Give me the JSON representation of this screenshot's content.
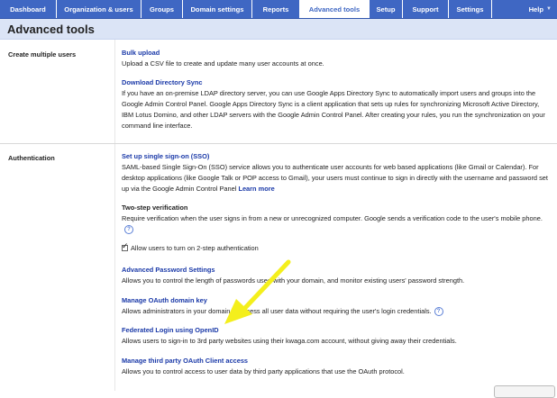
{
  "nav": {
    "tabs": [
      {
        "label": "Dashboard"
      },
      {
        "label": "Organization & users"
      },
      {
        "label": "Groups"
      },
      {
        "label": "Domain settings"
      },
      {
        "label": "Reports"
      },
      {
        "label": "Advanced tools",
        "active": true
      },
      {
        "label": "Setup"
      },
      {
        "label": "Support"
      },
      {
        "label": "Settings"
      }
    ],
    "help_label": "Help"
  },
  "page": {
    "title": "Advanced tools"
  },
  "sections": {
    "create_users": {
      "label": "Create multiple users",
      "bulk_upload": {
        "title": "Bulk upload",
        "text": "Upload a CSV file to create and update many user accounts at once."
      },
      "directory_sync": {
        "title": "Download Directory Sync",
        "text": "If you have an on-premise LDAP directory server, you can use Google Apps Directory Sync to automatically import users and groups into the Google Admin Control Panel. Google Apps Directory Sync is a client application that sets up rules for synchronizing Microsoft Active Directory, IBM Lotus Domino, and other LDAP servers with the Google Admin Control Panel. After creating your rules, you run the synchronization on your command line interface."
      }
    },
    "authentication": {
      "label": "Authentication",
      "sso": {
        "title": "Set up single sign-on (SSO)",
        "text": "SAML-based Single Sign-On (SSO) service allows you to authenticate user accounts for web based applications (like Gmail or Calendar). For desktop applications (like Google Talk or POP access to Gmail), your users must continue to sign in directly with the username and password set up via the Google Admin Control Panel",
        "learn_more": "Learn more"
      },
      "two_step": {
        "title": "Two-step verification",
        "text": "Require verification when the user signs in from a new or unrecognized computer. Google sends a verification code to the user's mobile phone.",
        "checkbox_label": "Allow users to turn on 2-step authentication",
        "checked": true
      },
      "password": {
        "title": "Advanced Password Settings",
        "text": "Allows you to control the length of passwords used with your domain, and monitor existing users' password strength."
      },
      "oauth_key": {
        "title": "Manage OAuth domain key",
        "text": "Allows administrators in your domain to access all user data without requiring the user's login credentials."
      },
      "openid": {
        "title": "Federated Login using OpenID",
        "text": "Allows users to sign-in to 3rd party websites using their kwaga.com account, without giving away their credentials."
      },
      "oauth_client": {
        "title": "Manage third party OAuth Client access",
        "text": "Allows you to control access to user data by third party applications that use the OAuth protocol."
      }
    }
  },
  "colors": {
    "nav_bg": "#3f67c3",
    "header_bg": "#dbe4f6",
    "link": "#1a39a8",
    "arrow": "#f4ef1c"
  },
  "icons": {
    "info": "info-icon",
    "arrow": "yellow-arrow-annotation"
  }
}
